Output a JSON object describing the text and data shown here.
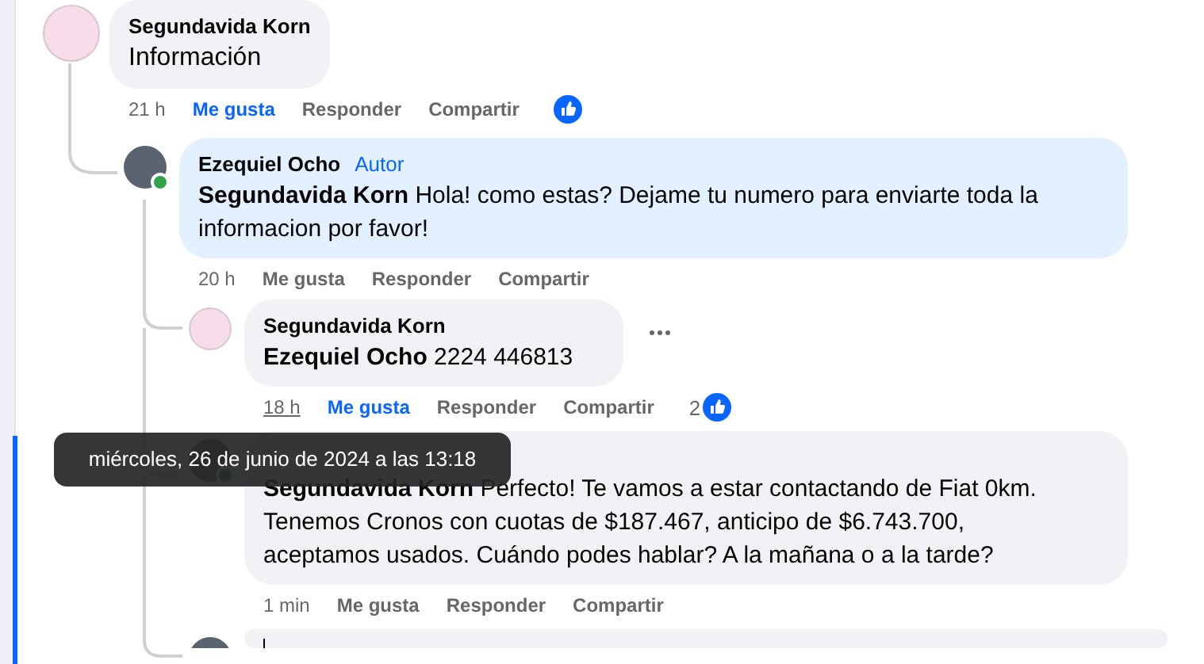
{
  "comments": [
    {
      "author": "Segundavida Korn",
      "avatar": {
        "kind": "logo"
      },
      "text": "Información",
      "time": "21 h",
      "like": "Me gusta",
      "liked": true,
      "reply": "Responder",
      "share": "Compartir",
      "reacted": true,
      "children": [
        {
          "author": "Ezequiel Ocho",
          "avatar": {
            "kind": "photo"
          },
          "online": true,
          "badge": "Autor",
          "highlighted": true,
          "mention": "Segundavida Korn",
          "text": "Hola! como estas? Dejame tu numero para enviarte toda la informacion por favor!",
          "time": "20 h",
          "like": "Me gusta",
          "liked": false,
          "reply": "Responder",
          "share": "Compartir",
          "children": [
            {
              "author": "Segundavida Korn",
              "avatar": {
                "kind": "logo"
              },
              "mention": "Ezequiel Ocho",
              "text": "2224 446813",
              "time": "18 h",
              "time_hovered": true,
              "like": "Me gusta",
              "liked": true,
              "reply": "Responder",
              "share": "Compartir",
              "reacted": true,
              "reaction_count": "2",
              "more_menu": true
            },
            {
              "avatar": {
                "kind": "photo"
              },
              "online": true,
              "mention": "Segundavida Korn",
              "text": "Perfecto! Te vamos a estar contactando de Fiat 0km. Tenemos Cronos con cuotas de $187.467, anticipo de $6.743.700, aceptamos usados. Cuándo podes hablar? A la mañana o a la tarde?",
              "time": "1 min",
              "like": "Me gusta",
              "liked": false,
              "reply": "Responder",
              "share": "Compartir"
            }
          ],
          "reply_box": {
            "avatar": {
              "kind": "photo"
            },
            "focused": true
          }
        }
      ]
    }
  ],
  "tooltip": {
    "text": "miércoles, 26 de junio de 2024 a las 13:18"
  }
}
